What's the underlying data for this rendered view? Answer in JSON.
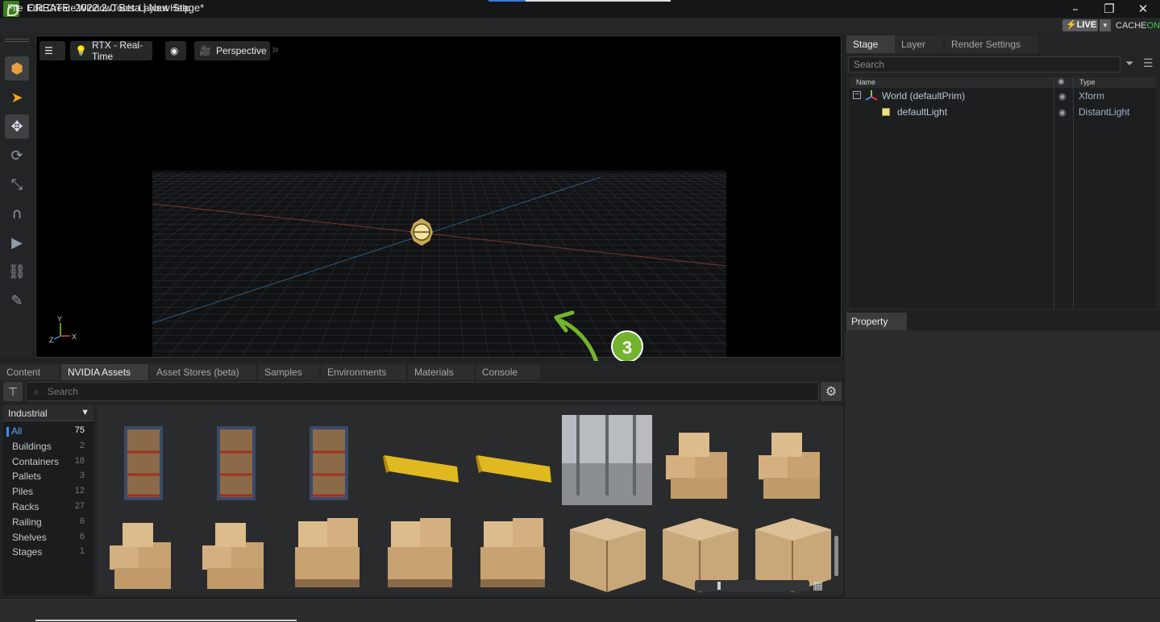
{
  "app": {
    "title": "CREATE  2022.2.0 Beta | New Stage*",
    "window_buttons": [
      "–",
      "❐",
      "✕"
    ]
  },
  "menu": [
    "File",
    "Edit",
    "Create",
    "Window",
    "Tools",
    "Layout",
    "Help"
  ],
  "live": {
    "label": "LIVE",
    "cache_prefix": "CACHE",
    "cache_suffix": "ON"
  },
  "left_toolbar": [
    "select-mode",
    "select",
    "move",
    "rotate",
    "scale",
    "snap",
    "play",
    "physics",
    "paint"
  ],
  "viewport": {
    "render_mode": "RTX - Real-Time",
    "camera": "Perspective",
    "axis": {
      "y": "Y",
      "z": "Z",
      "x": "X"
    }
  },
  "callout": {
    "number": "3"
  },
  "bottom_tabs": [
    "Content",
    "NVIDIA Assets",
    "Asset Stores (beta)",
    "Samples",
    "Environments",
    "Materials",
    "Console"
  ],
  "asset_search": {
    "placeholder": "Search"
  },
  "categories": {
    "group": "Industrial",
    "items": [
      {
        "label": "All",
        "count": "75"
      },
      {
        "label": "Buildings",
        "count": "2"
      },
      {
        "label": "Containers",
        "count": "18"
      },
      {
        "label": "Pallets",
        "count": "3"
      },
      {
        "label": "Piles",
        "count": "12"
      },
      {
        "label": "Racks",
        "count": "27"
      },
      {
        "label": "Railing",
        "count": "6"
      },
      {
        "label": "Shelves",
        "count": "6"
      },
      {
        "label": "Stages",
        "count": "1"
      }
    ]
  },
  "thumbnails": [
    "rack",
    "rack",
    "rack",
    "railing",
    "railing",
    "warehouse-stage",
    "box-pile",
    "box-pile",
    "box-pile",
    "box-pile",
    "box-pallet",
    "box-pallet",
    "box-pallet",
    "crate",
    "crate",
    "crate"
  ],
  "stage": {
    "tabs": [
      "Stage",
      "Layer",
      "Render Settings"
    ],
    "search_placeholder": "Search",
    "columns": {
      "name": "Name",
      "type": "Type"
    },
    "rows": [
      {
        "name": "World (defaultPrim)",
        "type": "Xform"
      },
      {
        "name": "defaultLight",
        "type": "DistantLight"
      }
    ]
  },
  "property": {
    "tab": "Property"
  },
  "colors": {
    "accent": "#74b32e",
    "selection": "#3a8cff",
    "live_bolt": "#ffd21e"
  }
}
